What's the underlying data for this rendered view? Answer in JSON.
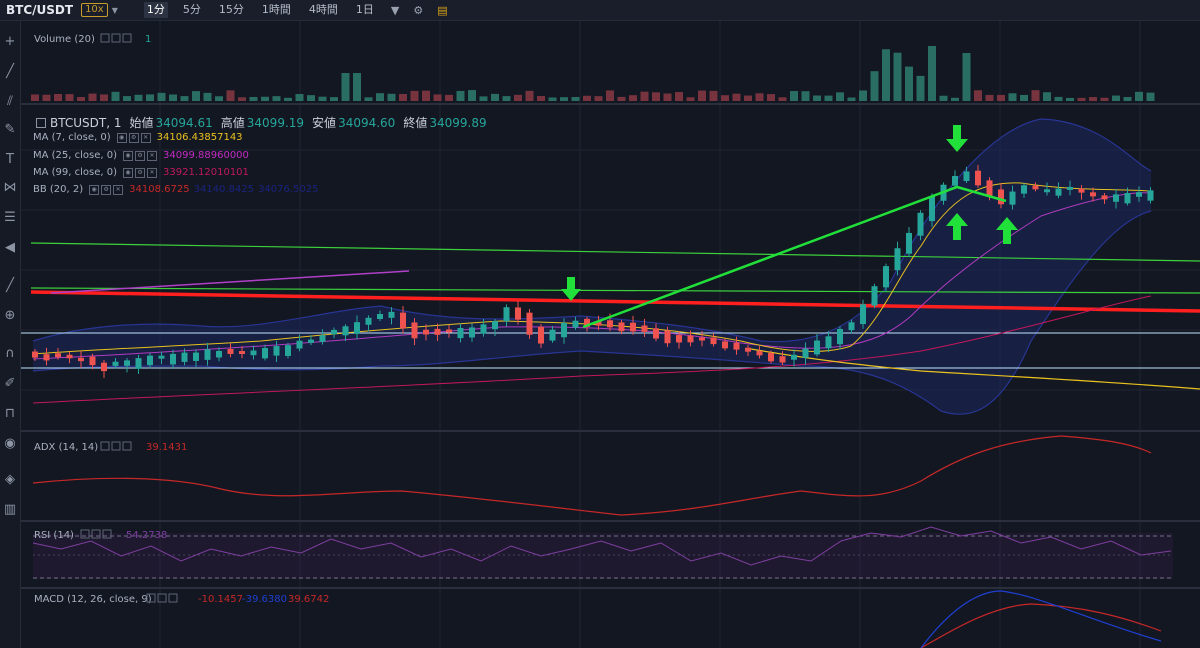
{
  "header": {
    "symbol": "BTC/USDT",
    "leverage": "10x",
    "timeframes": [
      {
        "label": "1分",
        "active": true
      },
      {
        "label": "5分",
        "active": false
      },
      {
        "label": "15分",
        "active": false
      },
      {
        "label": "1時間",
        "active": false
      },
      {
        "label": "4時間",
        "active": false
      },
      {
        "label": "1日",
        "active": false
      }
    ],
    "more_icon": "caret-down-icon",
    "settings_icon": "sliders-icon",
    "notes_icon": "notebook-icon"
  },
  "toolbar_icons": [
    "crosshair-icon",
    "trend-line-icon",
    "parallel-channel-icon",
    "brush-icon",
    "text-icon",
    "pattern-icon",
    "measure-icon",
    "back-arrow-icon",
    "ruler-icon",
    "zoom-icon",
    "magnet-icon",
    "lock-drawing-icon",
    "unlock-icon",
    "eye-icon",
    "layers-icon",
    "trash-icon"
  ],
  "volume": {
    "label": "Volume (20)",
    "value": "1"
  },
  "main": {
    "title": "BTCUSDT, 1",
    "open_label": "始値",
    "open": "34094.61",
    "high_label": "高値",
    "high": "34099.19",
    "low_label": "安値",
    "low": "34094.60",
    "close_label": "終値",
    "close": "34099.89",
    "indicators": [
      {
        "label": "MA (7, close, 0)",
        "value": "34106.43857143",
        "color": "#e8c11f"
      },
      {
        "label": "MA (25, close, 0)",
        "value": "34099.88960000",
        "color": "#c42ac4"
      },
      {
        "label": "MA (99, close, 0)",
        "value": "33921.12010101",
        "color": "#c2185b"
      },
      {
        "label": "BB (20, 2)",
        "value": "34108.6725",
        "value2": "34140.8425",
        "value3": "34076.5025",
        "color": "#c62828",
        "color2": "#1a237e"
      }
    ]
  },
  "adx": {
    "label": "ADX (14, 14)",
    "value": "39.1431"
  },
  "rsi": {
    "label": "RSI (14)",
    "value": "54.2738"
  },
  "macd": {
    "label": "MACD (12, 26, close, 9)",
    "value": "-10.1457",
    "value2": "-39.6380",
    "value3": "39.6742"
  },
  "colors": {
    "up": "#26a69a",
    "down": "#ef5350",
    "background": "#131722",
    "annotation": "#22e03a",
    "red_line": "#ff1f1f"
  }
}
